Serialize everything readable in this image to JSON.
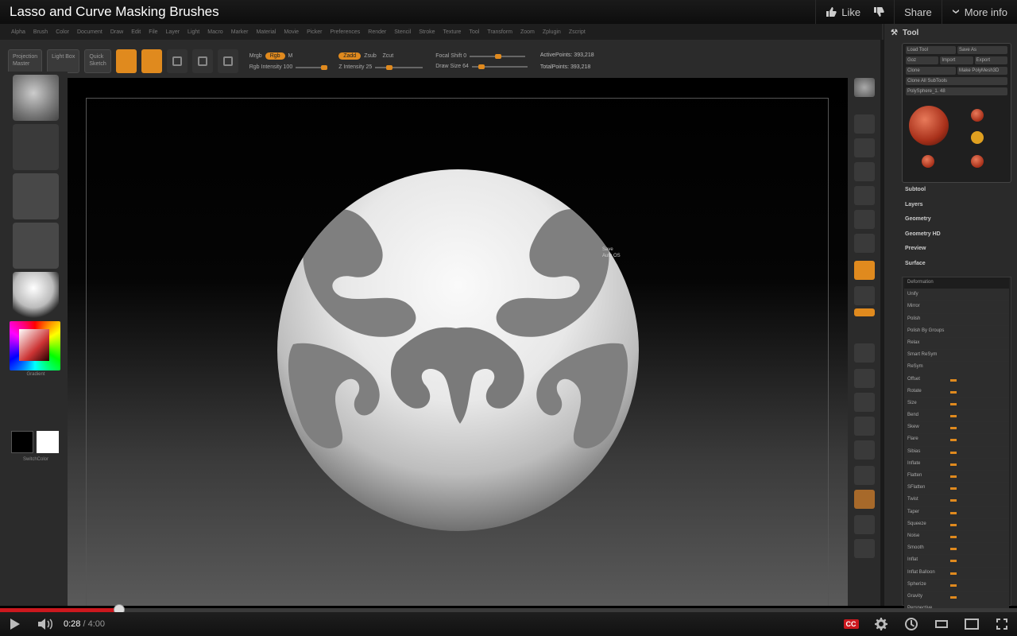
{
  "video": {
    "title": "Lasso and Curve Masking Brushes",
    "actions": {
      "like": "Like",
      "share": "Share",
      "more_info": "More info"
    },
    "time": {
      "current": "0:28",
      "separator": " / ",
      "duration": "4:00"
    },
    "progress_fraction": 0.117,
    "cc": "CC"
  },
  "colors": {
    "accent": "#e08a1e",
    "youtube_red": "#cc181e"
  },
  "zbrush": {
    "tool_panel": {
      "title": "Tool",
      "buttons": [
        [
          "Load Tool",
          "Save As"
        ],
        [
          "Goz",
          "Import",
          "Export"
        ],
        [
          "Clone",
          "Make PolyMesh3D"
        ],
        [
          "Clone All SubTools"
        ],
        [
          "PolySphere_1. 48"
        ]
      ],
      "sections": [
        "Subtool",
        "Layers",
        "Geometry",
        "Geometry HD",
        "Preview",
        "Surface"
      ],
      "deformation_header": "Deformation",
      "deformation_rows": [
        "Unify",
        "Mirror",
        "Polish",
        "Polish By Groups",
        "Relax",
        "Smart ReSym",
        "ReSym",
        "Offset",
        "Rotate",
        "Size",
        "Bend",
        "Skew",
        "Flare",
        "Sibias",
        "Inflate",
        "Flatten",
        "SFlatten",
        "Twist",
        "Taper",
        "Squeeze",
        "Noise",
        "Smooth",
        "Inflat",
        "Inflat Balloon",
        "Spherize",
        "Gravity",
        "Perspective"
      ]
    },
    "canvas_note": [
      "Save",
      "Auth OS"
    ],
    "left_shelf": {
      "gradient_label": "Gradient",
      "switch_label": "SwitchColor"
    }
  }
}
